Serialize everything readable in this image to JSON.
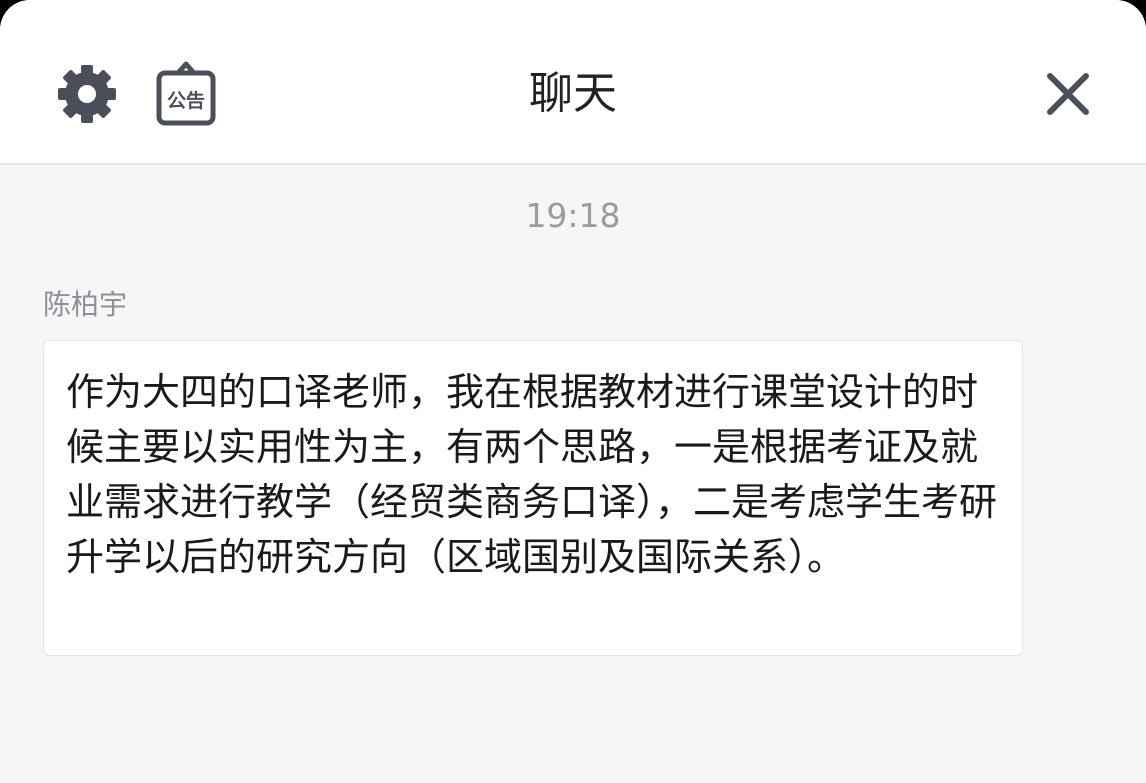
{
  "header": {
    "title": "聊天",
    "settings_icon": "gear-icon",
    "notice_icon": "announcement-icon",
    "notice_label": "公告",
    "close_icon": "close-icon",
    "icon_color": "#4a4f5a"
  },
  "chat": {
    "timestamp": "19:18",
    "messages": [
      {
        "sender": "陈柏宇",
        "text": "作为大四的口译老师，我在根据教材进行课堂设计的时候主要以实用性为主，有两个思路，一是根据考证及就业需求进行教学（经贸类商务口译），二是考虑学生考研升学以后的研究方向（区域国别及国际关系）。"
      }
    ]
  }
}
